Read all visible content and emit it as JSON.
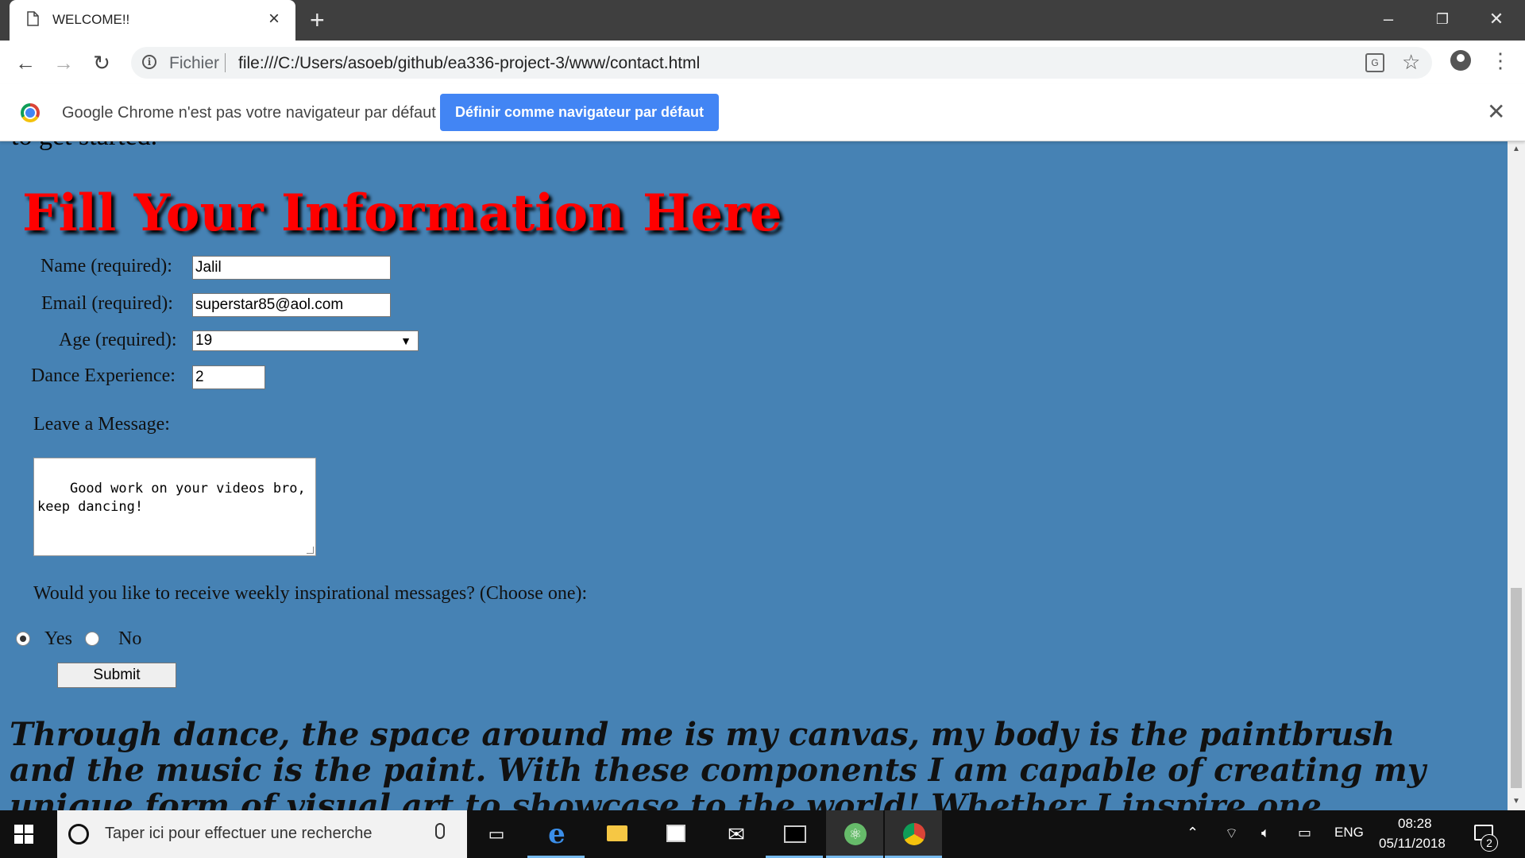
{
  "browser": {
    "tab_title": "WELCOME!!",
    "address_scheme_label": "Fichier",
    "url": "file:///C:/Users/asoeb/github/ea336-project-3/www/contact.html"
  },
  "infobar": {
    "message": "Google Chrome n'est pas votre navigateur par défaut",
    "button_label": "Définir comme navigateur par défaut"
  },
  "page": {
    "cut_text": "to get started.",
    "heading": "Fill Your Information Here",
    "name_label": "Name (required):",
    "name_value": "Jalil",
    "email_label": "Email (required):",
    "email_value": "superstar85@aol.com",
    "age_label": "Age (required):",
    "age_value": "19",
    "experience_label": "Dance Experience:",
    "experience_value": "2",
    "message_label": "Leave a Message:",
    "message_value": "Good work on your videos bro,\nkeep dancing!",
    "question": "Would you like to receive weekly inspirational messages? (Choose one):",
    "yes_label": "Yes",
    "no_label": "No",
    "selected_option": "Yes",
    "submit_label": "Submit",
    "quote": "Through dance, the space around me is my canvas, my body is the paintbrush and the music is the paint. With these components I am capable of creating my unique form of visual art to showcase to the world! Whether I inspire one person or a multitude of"
  },
  "taskbar": {
    "search_placeholder": "Taper ici pour effectuer une recherche",
    "language": "ENG",
    "time": "08:28",
    "date": "05/11/2018",
    "notification_count": "2"
  },
  "colors": {
    "page_background": "#4682b4",
    "heading": "#ff0000",
    "infobar_button": "#4285f4"
  }
}
